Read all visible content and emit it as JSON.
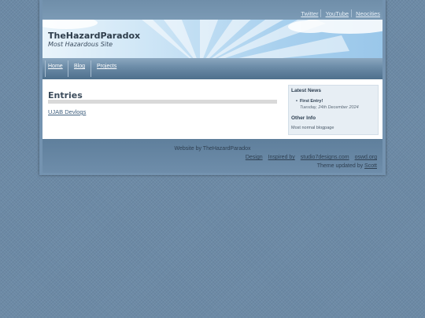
{
  "top_links": [
    "Twitter",
    "YouTube",
    "Neocities"
  ],
  "header": {
    "title": "TheHazardParadox",
    "subtitle": "Most Hazardous Site"
  },
  "nav": [
    "Home",
    "Blog",
    "Projects"
  ],
  "main": {
    "heading": "Entries",
    "posts": [
      "UJAB Devlogs"
    ]
  },
  "sidebar": {
    "latest_heading": "Latest News",
    "news_title": "First Entry!",
    "news_date": "Tuesday, 24th December 2024",
    "other_heading": "Other Info",
    "other_text": "Most normal blogpage"
  },
  "footer": {
    "credit": "Website by TheHazardParadox",
    "links": [
      "Design",
      "Inspired by",
      "studio7designs.com",
      "oswd.org"
    ],
    "theme_prefix": "Theme updated by",
    "theme_author": "Scott"
  },
  "colors": {
    "page_bg": "#6c8aa6",
    "nav_bg": "#5a7b98",
    "sidebar_bg": "#e7eef4",
    "link": "#3f5f7e"
  }
}
